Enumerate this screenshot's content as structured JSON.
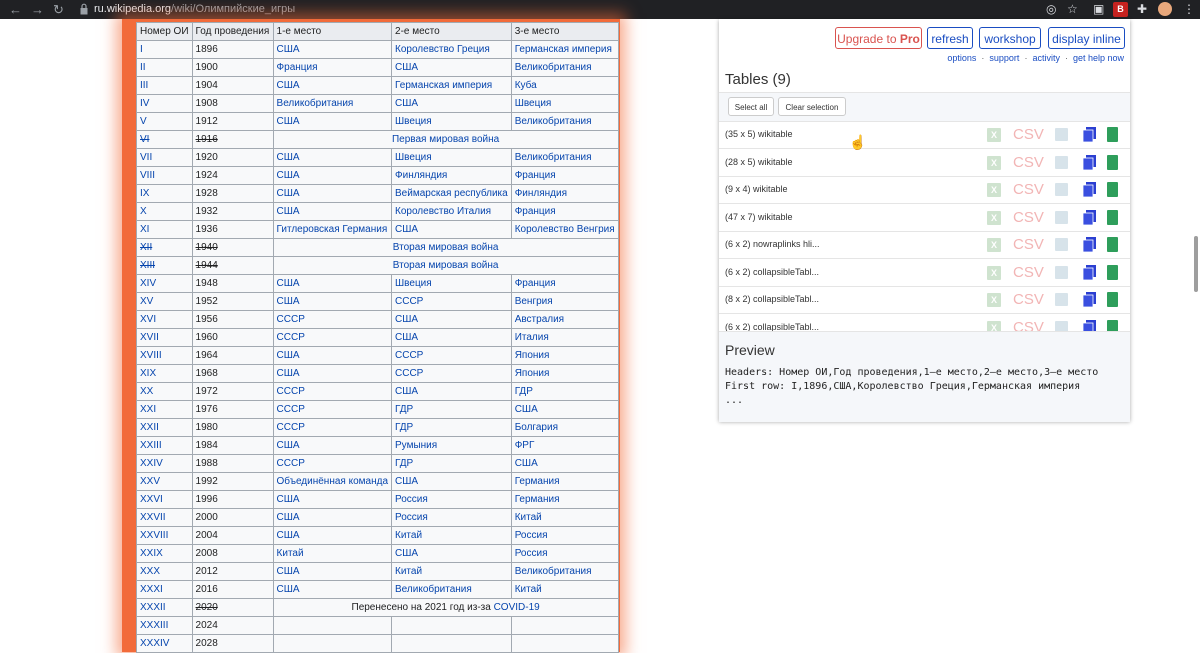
{
  "browser": {
    "url_domain": "ru.wikipedia.org",
    "url_path": "/wiki/Олимпийские_игры",
    "ext_badge": "B"
  },
  "wiki_table": {
    "headers": [
      "Номер ОИ",
      "Год проведения",
      "1-е место",
      "2-е место",
      "3-е место"
    ],
    "rows": [
      {
        "n": "I",
        "y": "1896",
        "p1": "США",
        "p2": "Королевство Греция",
        "p3": "Германская империя"
      },
      {
        "n": "II",
        "y": "1900",
        "p1": "Франция",
        "p2": "США",
        "p3": "Великобритания"
      },
      {
        "n": "III",
        "y": "1904",
        "p1": "США",
        "p2": "Германская империя",
        "p3": "Куба"
      },
      {
        "n": "IV",
        "y": "1908",
        "p1": "Великобритания",
        "p2": "США",
        "p3": "Швеция"
      },
      {
        "n": "V",
        "y": "1912",
        "p1": "США",
        "p2": "Швеция",
        "p3": "Великобритания"
      },
      {
        "n": "VI",
        "y": "1916",
        "span": "Первая мировая война",
        "struck": true
      },
      {
        "n": "VII",
        "y": "1920",
        "p1": "США",
        "p2": "Швеция",
        "p3": "Великобритания"
      },
      {
        "n": "VIII",
        "y": "1924",
        "p1": "США",
        "p2": "Финляндия",
        "p3": "Франция"
      },
      {
        "n": "IX",
        "y": "1928",
        "p1": "США",
        "p2": "Веймарская республика",
        "p3": "Финляндия"
      },
      {
        "n": "X",
        "y": "1932",
        "p1": "США",
        "p2": "Королевство Италия",
        "p3": "Франция"
      },
      {
        "n": "XI",
        "y": "1936",
        "p1": "Гитлеровская Германия",
        "p2": "США",
        "p3": "Королевство Венгрия"
      },
      {
        "n": "XII",
        "y": "1940",
        "span": "Вторая мировая война",
        "struck": true
      },
      {
        "n": "XIII",
        "y": "1944",
        "span": "Вторая мировая война",
        "struck": true
      },
      {
        "n": "XIV",
        "y": "1948",
        "p1": "США",
        "p2": "Швеция",
        "p3": "Франция"
      },
      {
        "n": "XV",
        "y": "1952",
        "p1": "США",
        "p2": "СССР",
        "p3": "Венгрия"
      },
      {
        "n": "XVI",
        "y": "1956",
        "p1": "СССР",
        "p2": "США",
        "p3": "Австралия"
      },
      {
        "n": "XVII",
        "y": "1960",
        "p1": "СССР",
        "p2": "США",
        "p3": "Италия"
      },
      {
        "n": "XVIII",
        "y": "1964",
        "p1": "США",
        "p2": "СССР",
        "p3": "Япония"
      },
      {
        "n": "XIX",
        "y": "1968",
        "p1": "США",
        "p2": "СССР",
        "p3": "Япония"
      },
      {
        "n": "XX",
        "y": "1972",
        "p1": "СССР",
        "p2": "США",
        "p3": "ГДР"
      },
      {
        "n": "XXI",
        "y": "1976",
        "p1": "СССР",
        "p2": "ГДР",
        "p3": "США"
      },
      {
        "n": "XXII",
        "y": "1980",
        "p1": "СССР",
        "p2": "ГДР",
        "p3": "Болгария"
      },
      {
        "n": "XXIII",
        "y": "1984",
        "p1": "США",
        "p2": "Румыния",
        "p3": "ФРГ"
      },
      {
        "n": "XXIV",
        "y": "1988",
        "p1": "СССР",
        "p2": "ГДР",
        "p3": "США"
      },
      {
        "n": "XXV",
        "y": "1992",
        "p1": "Объединённая команда",
        "p2": "США",
        "p3": "Германия"
      },
      {
        "n": "XXVI",
        "y": "1996",
        "p1": "США",
        "p2": "Россия",
        "p3": "Германия"
      },
      {
        "n": "XXVII",
        "y": "2000",
        "p1": "США",
        "p2": "Россия",
        "p3": "Китай"
      },
      {
        "n": "XXVIII",
        "y": "2004",
        "p1": "США",
        "p2": "Китай",
        "p3": "Россия"
      },
      {
        "n": "XXIX",
        "y": "2008",
        "p1": "Китай",
        "p2": "США",
        "p3": "Россия"
      },
      {
        "n": "XXX",
        "y": "2012",
        "p1": "США",
        "p2": "Китай",
        "p3": "Великобритания"
      },
      {
        "n": "XXXI",
        "y": "2016",
        "p1": "США",
        "p2": "Великобритания",
        "p3": "Китай"
      },
      {
        "n": "XXXII",
        "y": "2020",
        "postponed_text": "Перенесено на 2021 год из-за ",
        "postponed_link": "COVID-19",
        "struck_year": true
      },
      {
        "n": "XXXIII",
        "y": "2024",
        "p1": "",
        "p2": "",
        "p3": ""
      },
      {
        "n": "XXXIV",
        "y": "2028",
        "p1": "",
        "p2": "",
        "p3": ""
      }
    ]
  },
  "panel": {
    "upgrade_prefix": "Upgrade to ",
    "upgrade_pro": "Pro",
    "refresh": "refresh",
    "workshop": "workshop",
    "display_inline": "display inline",
    "links": [
      "options",
      "support",
      "activity",
      "get help now"
    ],
    "tables_title": "Tables (9)",
    "select_all": "Select all",
    "clear_selection": "Clear selection",
    "csv_label": "CSV",
    "tables": [
      "(35 x 5) wikitable",
      "(28 x 5) wikitable",
      "(9 x 4) wikitable",
      "(47 x 7) wikitable",
      "(6 x 2) nowraplinks hli...",
      "(6 x 2) collapsibleTabl...",
      "(8 x 2) collapsibleTabl...",
      "(6 x 2) collapsibleTabl..."
    ],
    "preview_title": "Preview",
    "preview_lines": [
      "Headers: Номер ОИ,Год проведения,1–е место,2–е место,3–е место",
      "First row: I,1896,США,Королевство Греция,Германская империя",
      "..."
    ]
  },
  "colors": {
    "highlight": "#f26b3a",
    "link": "#0645ad",
    "pro_red": "#d9534f",
    "panel_blue": "#1a4dc2"
  }
}
